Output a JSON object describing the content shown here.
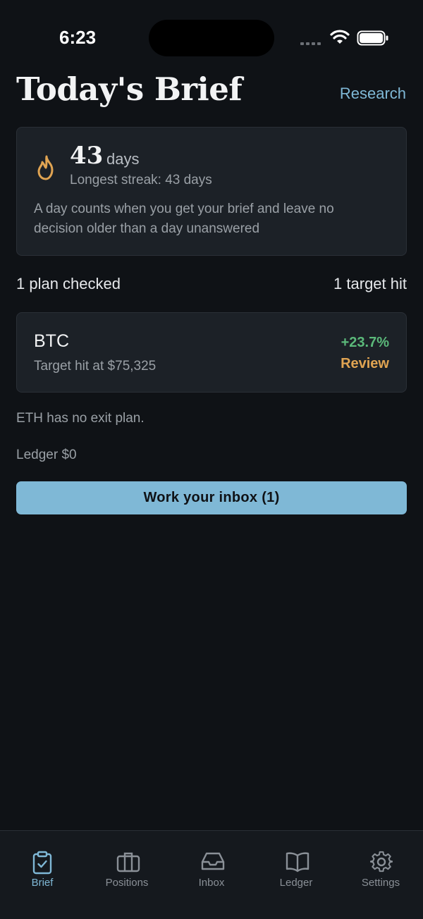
{
  "status_bar": {
    "time": "6:23"
  },
  "header": {
    "title": "Today's Brief",
    "research_label": "Research"
  },
  "streak": {
    "count": "43",
    "unit": "days",
    "longest": "Longest streak: 43 days",
    "description": "A day counts when you get your brief and leave no decision older than a day unanswered",
    "icon": "flame-icon",
    "icon_color": "#e0a452"
  },
  "summary": {
    "plans_checked": "1 plan checked",
    "targets_hit": "1 target hit"
  },
  "position": {
    "symbol": "BTC",
    "subtitle": "Target hit at $75,325",
    "change": "+23.7%",
    "action": "Review"
  },
  "notes": {
    "eth": "ETH has no exit plan.",
    "ledger": "Ledger $0"
  },
  "cta": {
    "label": "Work your inbox (1)"
  },
  "tabs": [
    {
      "label": "Brief",
      "icon": "clipboard-check-icon",
      "active": true
    },
    {
      "label": "Positions",
      "icon": "briefcase-icon",
      "active": false
    },
    {
      "label": "Inbox",
      "icon": "inbox-tray-icon",
      "active": false
    },
    {
      "label": "Ledger",
      "icon": "open-book-icon",
      "active": false
    },
    {
      "label": "Settings",
      "icon": "gear-icon",
      "active": false
    }
  ],
  "colors": {
    "accent": "#7fb8d6",
    "positive": "#5bb97a",
    "warning": "#e0a452",
    "background": "#0f1216",
    "card": "#1c2127"
  }
}
